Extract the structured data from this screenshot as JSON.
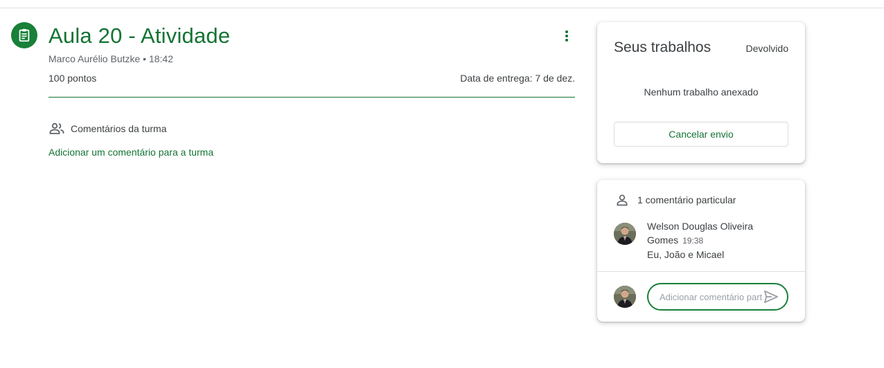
{
  "assignment": {
    "title": "Aula 20 - Atividade",
    "meta": "Marco Aurélio Butzke • 18:42",
    "points": "100 pontos",
    "due": "Data de entrega: 7 de dez.",
    "icon": "assignment-icon",
    "menu_icon": "more-vert-icon"
  },
  "class_comments": {
    "label": "Comentários da turma",
    "add_link": "Adicionar um comentário para a turma",
    "icon": "people-icon"
  },
  "your_work": {
    "title": "Seus trabalhos",
    "status": "Devolvido",
    "empty_text": "Nenhum trabalho anexado",
    "unsubmit_label": "Cancelar envio"
  },
  "private_comments": {
    "header": "1 comentário particular",
    "icon": "person-icon",
    "comments": [
      {
        "author": "Welson Douglas Oliveira Gomes",
        "time": "19:38",
        "text": "Eu, João e Micael"
      }
    ],
    "input_placeholder": "Adicionar comentário particular...",
    "send_icon": "send-icon"
  },
  "colors": {
    "accent": "#137333",
    "accent_bg": "#188038",
    "text": "#3c4043",
    "muted": "#5f6368"
  }
}
